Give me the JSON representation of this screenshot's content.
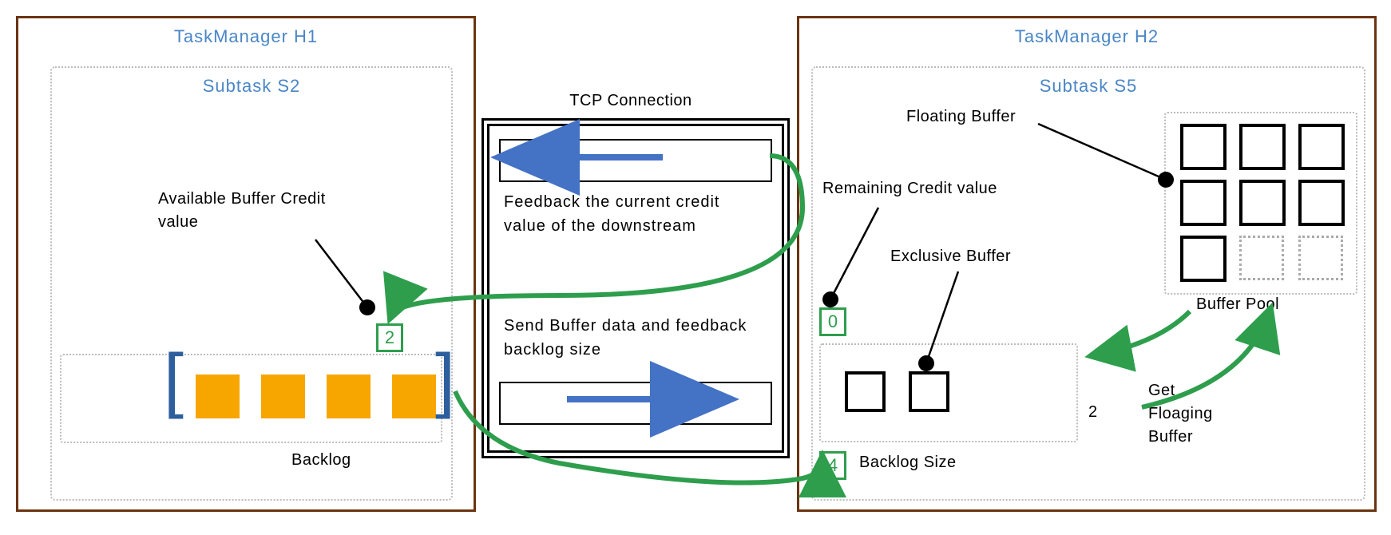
{
  "tm1": {
    "title": "TaskManager H1",
    "subtask": "Subtask S2"
  },
  "tm2": {
    "title": "TaskManager H2",
    "subtask": "Subtask S5"
  },
  "tcp": {
    "title": "TCP Connection",
    "feedback_text": "Feedback the current credit value of the downstream",
    "send_text": "Send Buffer data and feedback backlog size"
  },
  "labels": {
    "available_credit": "Available Buffer Credit value",
    "backlog": "Backlog",
    "remaining_credit": "Remaining Credit value",
    "exclusive_buffer": "Exclusive Buffer",
    "floating_buffer": "Floating Buffer",
    "buffer_pool": "Buffer Pool",
    "get_floating": "Get Floaging Buffer",
    "backlog_size": "Backlog Size"
  },
  "values": {
    "available_credit": "2",
    "remaining_credit": "0",
    "backlog_size": "4",
    "request_count": "2"
  },
  "chart_data": {
    "type": "diagram",
    "description": "Flink credit-based flow control between two TaskManagers over TCP",
    "nodes": [
      {
        "id": "H1",
        "label": "TaskManager H1",
        "subtask": "S2",
        "backlog_buffers": 4,
        "available_credit": 2
      },
      {
        "id": "TCP",
        "label": "TCP Connection",
        "channels": [
          "feedback-credit (downstream→upstream)",
          "send-data+backlog (upstream→downstream)"
        ]
      },
      {
        "id": "H2",
        "label": "TaskManager H2",
        "subtask": "S5",
        "remaining_credit": 0,
        "exclusive_buffers": 2,
        "backlog_size": 4,
        "floating_request": 2,
        "buffer_pool": {
          "floating_available": 7,
          "floating_empty_slots": 2
        }
      }
    ],
    "edges": [
      {
        "from": "H2",
        "to": "H1",
        "via": "TCP-top",
        "label": "Feedback the current credit value of the downstream"
      },
      {
        "from": "H1",
        "to": "H2",
        "via": "TCP-bottom",
        "label": "Send Buffer data and feedback backlog size"
      },
      {
        "from": "H2.subtask",
        "to": "H2.buffer_pool",
        "label": "Get Floating Buffer (request 2)"
      },
      {
        "from": "H2.buffer_pool",
        "to": "H2.subtask",
        "label": "return floating buffers"
      }
    ]
  }
}
